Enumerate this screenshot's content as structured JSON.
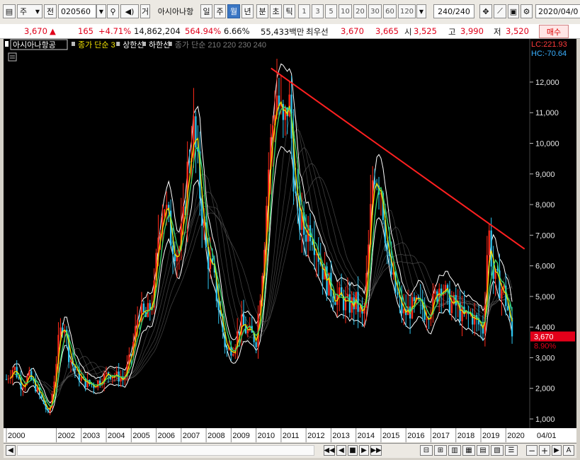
{
  "toolbar": {
    "market_label": "주",
    "prefix_label": "전",
    "code_value": "020560",
    "name_label": "아시아나항",
    "btn_ge": "거",
    "period_day": "일",
    "period_week": "주",
    "period_month": "월",
    "period_year": "년",
    "period_minute": "분",
    "period_second": "초",
    "period_tick": "틱",
    "intervals": [
      "1",
      "3",
      "5",
      "10",
      "20",
      "30",
      "60",
      "120"
    ],
    "count_value": "240",
    "count_total": "/240",
    "date_value": "2020/04/0"
  },
  "quote": {
    "price": "3,670",
    "change_arrow": "▲",
    "change": "165",
    "change_pct": "+4.71%",
    "volume": "14,862,204",
    "volume_pct": "564.94%",
    "turnover_pct": "6.66%",
    "amount": "55,433백만",
    "best_label": "최우선",
    "best_ask": "3,670",
    "best_bid": "3,665",
    "open_label": "시",
    "open": "3,525",
    "high_label": "고",
    "high": "3,990",
    "low_label": "저",
    "low": "3,520",
    "buy_button": "매수"
  },
  "chart_data": {
    "type": "candlestick",
    "title": "아시아나항공",
    "legend": [
      {
        "name": "종가 단순 3",
        "color": "#f0e000"
      },
      {
        "name": "상한선",
        "color": "#ffffff"
      },
      {
        "name": "하한선",
        "color": "#ffffff"
      },
      {
        "name": "종가 단순 210 220 230 240",
        "color": "#7a7a7a"
      }
    ],
    "y_ticks": [
      1000,
      2000,
      3000,
      4000,
      5000,
      6000,
      7000,
      8000,
      9000,
      10000,
      11000,
      12000
    ],
    "y_tick_labels": [
      "1,000",
      "2,000",
      "3,000",
      "4,000",
      "5,000",
      "6,000",
      "7,000",
      "8,000",
      "9,000",
      "10,000",
      "11,000",
      "12,000"
    ],
    "ylim": [
      700,
      12900
    ],
    "x_labels": [
      "2000",
      "2002",
      "2003",
      "2004",
      "2005",
      "2006",
      "2007",
      "2008",
      "2009",
      "2010",
      "2011",
      "2012",
      "2013",
      "2014",
      "2015",
      "2016",
      "2017",
      "2018",
      "2019",
      "2020"
    ],
    "x_last_label": "04/01",
    "indicator_lc": "LC:221.93",
    "indicator_hc": "HC:-70.64",
    "current_price_label": "3,670",
    "current_pct_label": "8.90%",
    "current_price": 3670,
    "trendline": {
      "start": {
        "x": 2010.6,
        "y": 12450
      },
      "end": {
        "x": 2020.75,
        "y": 6550
      },
      "color": "#ff2020"
    },
    "close_series": [
      {
        "x": 2000.0,
        "y": 2300
      },
      {
        "x": 2000.3,
        "y": 2700
      },
      {
        "x": 2000.6,
        "y": 2100
      },
      {
        "x": 2000.9,
        "y": 2400
      },
      {
        "x": 2001.2,
        "y": 2000
      },
      {
        "x": 2001.5,
        "y": 1500
      },
      {
        "x": 2001.7,
        "y": 1100
      },
      {
        "x": 2001.9,
        "y": 2200
      },
      {
        "x": 2002.1,
        "y": 3600
      },
      {
        "x": 2002.3,
        "y": 4300
      },
      {
        "x": 2002.5,
        "y": 3100
      },
      {
        "x": 2002.8,
        "y": 2500
      },
      {
        "x": 2003.1,
        "y": 2200
      },
      {
        "x": 2003.5,
        "y": 2100
      },
      {
        "x": 2003.8,
        "y": 2300
      },
      {
        "x": 2004.1,
        "y": 2500
      },
      {
        "x": 2004.4,
        "y": 2400
      },
      {
        "x": 2004.7,
        "y": 2300
      },
      {
        "x": 2005.0,
        "y": 3100
      },
      {
        "x": 2005.3,
        "y": 4500
      },
      {
        "x": 2005.6,
        "y": 4300
      },
      {
        "x": 2005.9,
        "y": 5000
      },
      {
        "x": 2006.1,
        "y": 7200
      },
      {
        "x": 2006.3,
        "y": 8200
      },
      {
        "x": 2006.6,
        "y": 6900
      },
      {
        "x": 2006.9,
        "y": 6400
      },
      {
        "x": 2007.1,
        "y": 7500
      },
      {
        "x": 2007.3,
        "y": 9600
      },
      {
        "x": 2007.5,
        "y": 10400
      },
      {
        "x": 2007.7,
        "y": 8800
      },
      {
        "x": 2008.0,
        "y": 6500
      },
      {
        "x": 2008.3,
        "y": 5600
      },
      {
        "x": 2008.6,
        "y": 4200
      },
      {
        "x": 2008.8,
        "y": 3200
      },
      {
        "x": 2009.1,
        "y": 3400
      },
      {
        "x": 2009.4,
        "y": 4100
      },
      {
        "x": 2009.7,
        "y": 3800
      },
      {
        "x": 2010.0,
        "y": 3600
      },
      {
        "x": 2010.3,
        "y": 6500
      },
      {
        "x": 2010.5,
        "y": 9200
      },
      {
        "x": 2010.8,
        "y": 11800
      },
      {
        "x": 2011.1,
        "y": 10300
      },
      {
        "x": 2011.3,
        "y": 11600
      },
      {
        "x": 2011.6,
        "y": 7900
      },
      {
        "x": 2011.9,
        "y": 7100
      },
      {
        "x": 2012.2,
        "y": 7300
      },
      {
        "x": 2012.5,
        "y": 6400
      },
      {
        "x": 2012.8,
        "y": 5500
      },
      {
        "x": 2013.1,
        "y": 5100
      },
      {
        "x": 2013.4,
        "y": 4900
      },
      {
        "x": 2013.7,
        "y": 4700
      },
      {
        "x": 2014.0,
        "y": 4800
      },
      {
        "x": 2014.3,
        "y": 4200
      },
      {
        "x": 2014.5,
        "y": 6500
      },
      {
        "x": 2014.7,
        "y": 9300
      },
      {
        "x": 2015.0,
        "y": 8600
      },
      {
        "x": 2015.3,
        "y": 6100
      },
      {
        "x": 2015.6,
        "y": 5100
      },
      {
        "x": 2015.9,
        "y": 4400
      },
      {
        "x": 2016.2,
        "y": 4600
      },
      {
        "x": 2016.5,
        "y": 4700
      },
      {
        "x": 2016.8,
        "y": 4500
      },
      {
        "x": 2017.1,
        "y": 4800
      },
      {
        "x": 2017.4,
        "y": 5500
      },
      {
        "x": 2017.7,
        "y": 4800
      },
      {
        "x": 2018.0,
        "y": 4700
      },
      {
        "x": 2018.3,
        "y": 4300
      },
      {
        "x": 2018.6,
        "y": 4400
      },
      {
        "x": 2018.9,
        "y": 4100
      },
      {
        "x": 2019.1,
        "y": 3900
      },
      {
        "x": 2019.3,
        "y": 7300
      },
      {
        "x": 2019.5,
        "y": 5600
      },
      {
        "x": 2019.7,
        "y": 5400
      },
      {
        "x": 2019.9,
        "y": 5200
      },
      {
        "x": 2020.1,
        "y": 4500
      },
      {
        "x": 2020.25,
        "y": 3670
      }
    ]
  },
  "scrollbar": {
    "left_arrow": "◀",
    "nav_first": "◀◀",
    "nav_prev": "◀",
    "nav_stop": "■",
    "nav_next": "▶",
    "nav_last": "▶▶",
    "minus": "−",
    "plus": "+",
    "auto": "A"
  }
}
